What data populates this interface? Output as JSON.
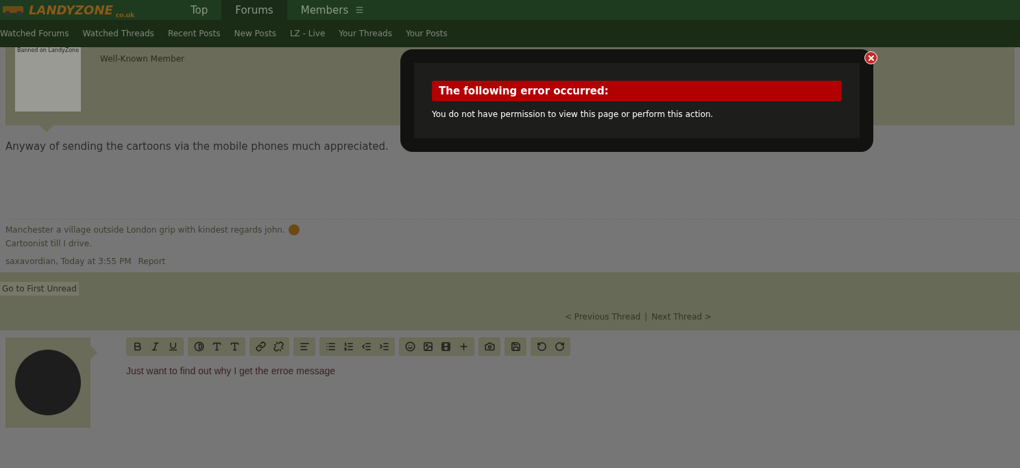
{
  "logo": {
    "name": "LANDYZONE",
    "domain": "co.uk"
  },
  "nav_tabs": [
    {
      "label": "Top",
      "selected": false
    },
    {
      "label": "Forums",
      "selected": true
    },
    {
      "label": "Members",
      "selected": false
    }
  ],
  "sub_nav": [
    "Watched Forums",
    "Watched Threads",
    "Recent Posts",
    "New Posts",
    "LZ - Live",
    "Your Threads",
    "Your Posts"
  ],
  "post": {
    "avatar_caption": "Banned on LandyZone",
    "user_title": "Well-Known Member",
    "message": "Anyway of sending the cartoons via the mobile phones much appreciated.",
    "signature": [
      "Manchester a village outside London grip with kindest regards john.",
      "Cartoonist till I drive."
    ],
    "meta": "saxavordian, Today at 3:55 PM",
    "report": "Report"
  },
  "thread_controls": {
    "first_unread": "Go to First Unread",
    "previous": "< Previous Thread",
    "separator": "|",
    "next": "Next Thread >"
  },
  "editor": {
    "value": "Just want to find out why I get the erroe message"
  },
  "error_dialog": {
    "heading": "The following error occurred:",
    "message": "You do not have permission to view this page or perform this action."
  }
}
